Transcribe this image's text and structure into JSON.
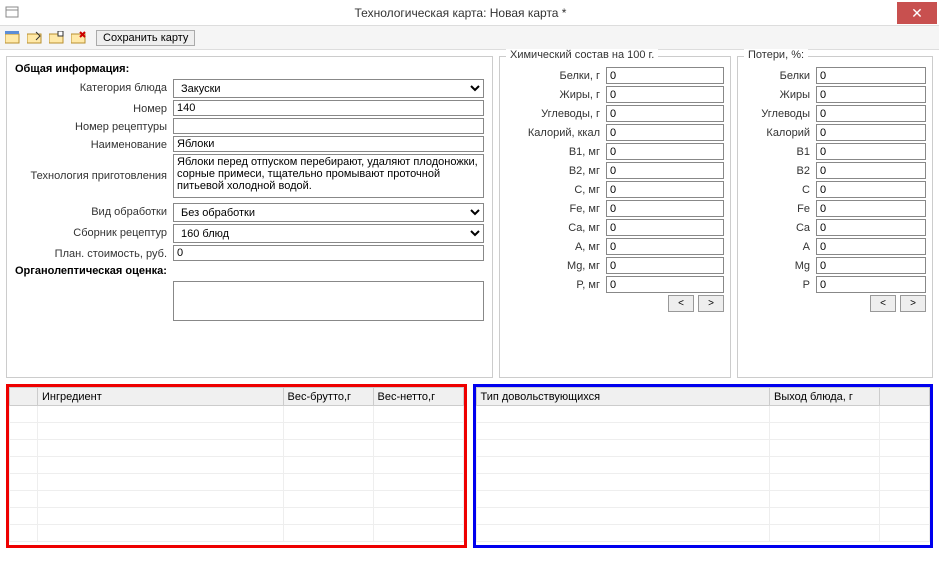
{
  "window": {
    "title": "Технологическая карта: Новая карта *"
  },
  "toolbar": {
    "save_label": "Сохранить карту"
  },
  "general": {
    "title": "Общая информация:",
    "category_label": "Категория блюда",
    "category_value": "Закуски",
    "number_label": "Номер",
    "number_value": "140",
    "recipe_number_label": "Номер рецептуры",
    "recipe_number_value": "",
    "name_label": "Наименование",
    "name_value": "Яблоки",
    "tech_label": "Технология приготовления",
    "tech_value": "Яблоки перед отпуском перебирают, удаляют плодоножки, сорные примеси, тщательно промывают проточной питьевой холодной водой.",
    "proc_type_label": "Вид обработки",
    "proc_type_value": "Без обработки",
    "recipe_book_label": "Сборник рецептур",
    "recipe_book_value": "160 блюд",
    "plan_cost_label": "План. стоимость, руб.",
    "plan_cost_value": "0",
    "organoleptic_label": "Органолептическая оценка:",
    "organoleptic_value": ""
  },
  "chem": {
    "title": "Химический состав на 100 г.",
    "rows": [
      {
        "label": "Белки, г",
        "value": "0"
      },
      {
        "label": "Жиры, г",
        "value": "0"
      },
      {
        "label": "Углеводы, г",
        "value": "0"
      },
      {
        "label": "Калорий, ккал",
        "value": "0"
      },
      {
        "label": "B1, мг",
        "value": "0"
      },
      {
        "label": "B2, мг",
        "value": "0"
      },
      {
        "label": "C, мг",
        "value": "0"
      },
      {
        "label": "Fe, мг",
        "value": "0"
      },
      {
        "label": "Ca, мг",
        "value": "0"
      },
      {
        "label": "A, мг",
        "value": "0"
      },
      {
        "label": "Mg, мг",
        "value": "0"
      },
      {
        "label": "P, мг",
        "value": "0"
      }
    ],
    "prev": "<",
    "next": ">"
  },
  "loss": {
    "title": "Потери, %:",
    "rows": [
      {
        "label": "Белки",
        "value": "0"
      },
      {
        "label": "Жиры",
        "value": "0"
      },
      {
        "label": "Углеводы",
        "value": "0"
      },
      {
        "label": "Калорий",
        "value": "0"
      },
      {
        "label": "B1",
        "value": "0"
      },
      {
        "label": "B2",
        "value": "0"
      },
      {
        "label": "C",
        "value": "0"
      },
      {
        "label": "Fe",
        "value": "0"
      },
      {
        "label": "Ca",
        "value": "0"
      },
      {
        "label": "A",
        "value": "0"
      },
      {
        "label": "Mg",
        "value": "0"
      },
      {
        "label": "P",
        "value": "0"
      }
    ],
    "prev": "<",
    "next": ">"
  },
  "ingredients_table": {
    "headers": [
      "Ингредиент",
      "Вес-брутто,г",
      "Вес-нетто,г"
    ]
  },
  "output_table": {
    "headers": [
      "Тип довольствующихся",
      "Выход блюда, г"
    ]
  }
}
